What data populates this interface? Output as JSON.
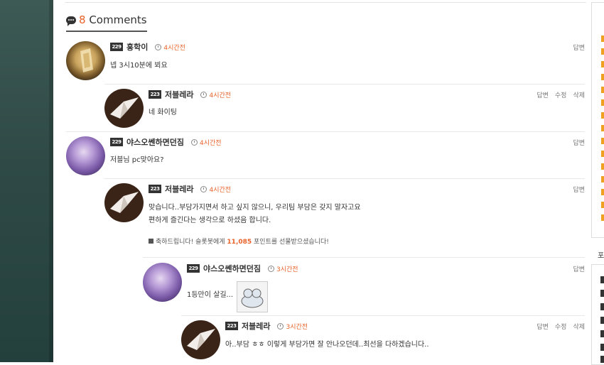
{
  "header": {
    "count": "8",
    "label": " Comments"
  },
  "comments": [
    {
      "level": "229",
      "author": "홍학이",
      "time": "4시간전",
      "text": "넵 3시10분에 뵈요",
      "actions": [
        "답변"
      ]
    },
    {
      "level": "223",
      "author": "저블레라",
      "time": "4시간전",
      "text": "네 화이팅",
      "actions": [
        "답변",
        "수정",
        "삭제"
      ]
    },
    {
      "level": "229",
      "author": "야스오쎈하면던짐",
      "time": "4시간전",
      "text": "저블님 pc맞아요?",
      "actions": [
        "답변"
      ]
    },
    {
      "level": "223",
      "author": "저블레라",
      "time": "4시간전",
      "text_line1": "맞습니다..부담가지면서 하고 싶지 않으니, 우리팀 부담은 갖지 말자고요",
      "text_line2": "편하게 즐긴다는 생각으로 하셨음 합니다.",
      "gift_prefix": "축하드립니다! 슬롯봇에게 ",
      "gift_points": "11,085",
      "gift_suffix": " 포인트를 선물받으셨습니다!",
      "actions": [
        "답변"
      ]
    },
    {
      "level": "229",
      "author": "야스오쎈하면던짐",
      "time": "3시간전",
      "text": "1등만이 살길...",
      "actions": [
        "답변"
      ]
    },
    {
      "level": "223",
      "author": "저블레라",
      "time": "3시간전",
      "text": "아..부담 ㅎㅎ 이렇게 부담가면 잘 안나오던데..최선을 다하겠습니다..",
      "actions": [
        "답변",
        "수정",
        "삭제"
      ]
    }
  ],
  "side": {
    "label": "포"
  },
  "colors": {
    "accent": "#e8622a",
    "sidebar_mark": "#f0a020"
  }
}
